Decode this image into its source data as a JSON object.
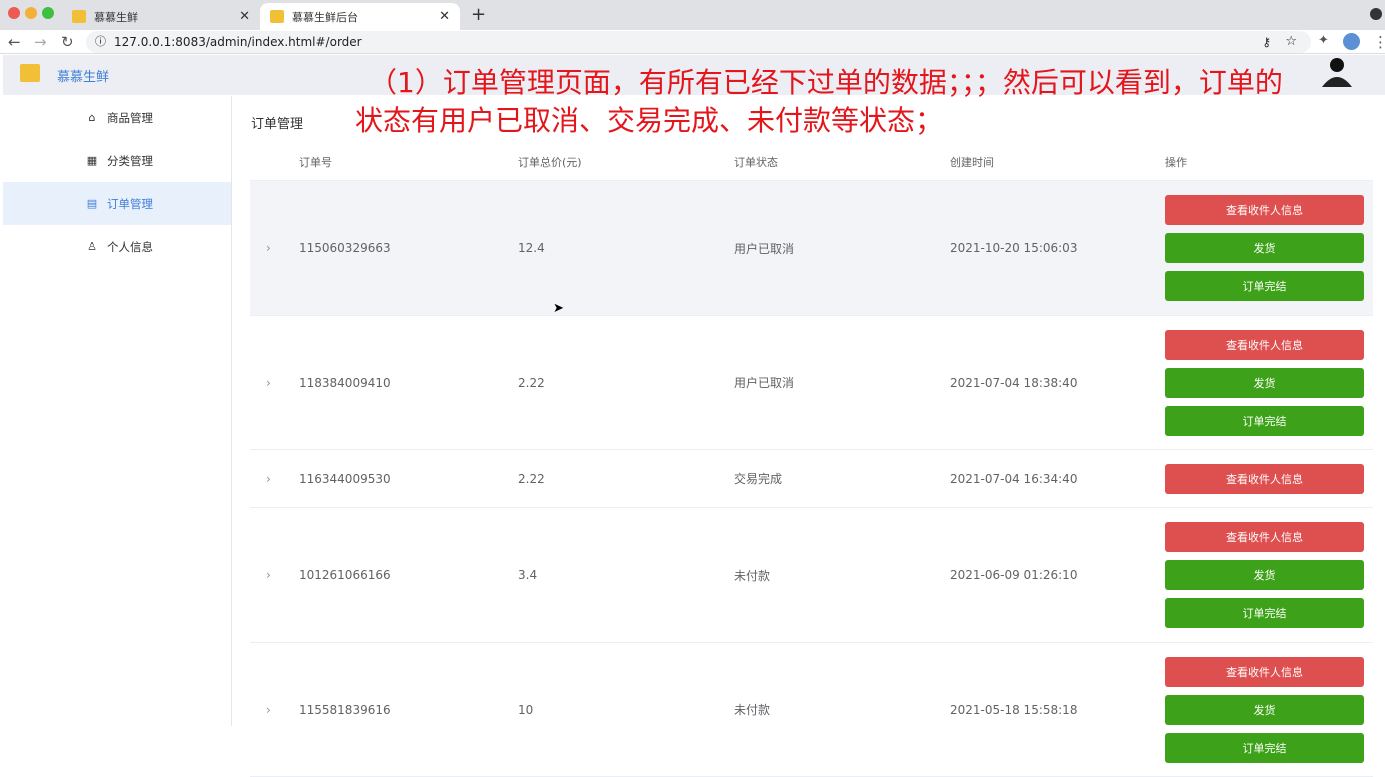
{
  "browser": {
    "tabs": [
      {
        "title": "慕慕生鲜",
        "active": false
      },
      {
        "title": "慕慕生鲜后台",
        "active": true
      }
    ],
    "url": "127.0.0.1:8083/admin/index.html#/order"
  },
  "app": {
    "brand": "慕慕生鲜"
  },
  "sidebar": {
    "items": [
      {
        "label": "商品管理",
        "icon": "bag-icon"
      },
      {
        "label": "分类管理",
        "icon": "grid-icon"
      },
      {
        "label": "订单管理",
        "icon": "order-icon",
        "active": true
      },
      {
        "label": "个人信息",
        "icon": "user-icon"
      }
    ]
  },
  "page": {
    "title": "订单管理"
  },
  "table": {
    "headers": [
      "订单号",
      "订单总价(元)",
      "订单状态",
      "创建时间",
      "操作"
    ],
    "buttons": {
      "view": "查看收件人信息",
      "ship": "发货",
      "finish": "订单完结"
    },
    "rows": [
      {
        "id": "115060329663",
        "price": "12.4",
        "status": "用户已取消",
        "time": "2021-10-20 15:06:03"
      },
      {
        "id": "118384009410",
        "price": "2.22",
        "status": "用户已取消",
        "time": "2021-07-04 18:38:40"
      },
      {
        "id": "116344009530",
        "price": "2.22",
        "status": "交易完成",
        "time": "2021-07-04 16:34:40"
      },
      {
        "id": "101261066166",
        "price": "3.4",
        "status": "未付款",
        "time": "2021-06-09 01:26:10"
      },
      {
        "id": "115581839616",
        "price": "10",
        "status": "未付款",
        "time": "2021-05-18 15:58:18"
      }
    ]
  },
  "annotation": {
    "line1": "（1）订单管理页面，有所有已经下过单的数据；；；然后可以看到，订单的",
    "line2": "状态有用户已取消、交易完成、未付款等状态；"
  }
}
